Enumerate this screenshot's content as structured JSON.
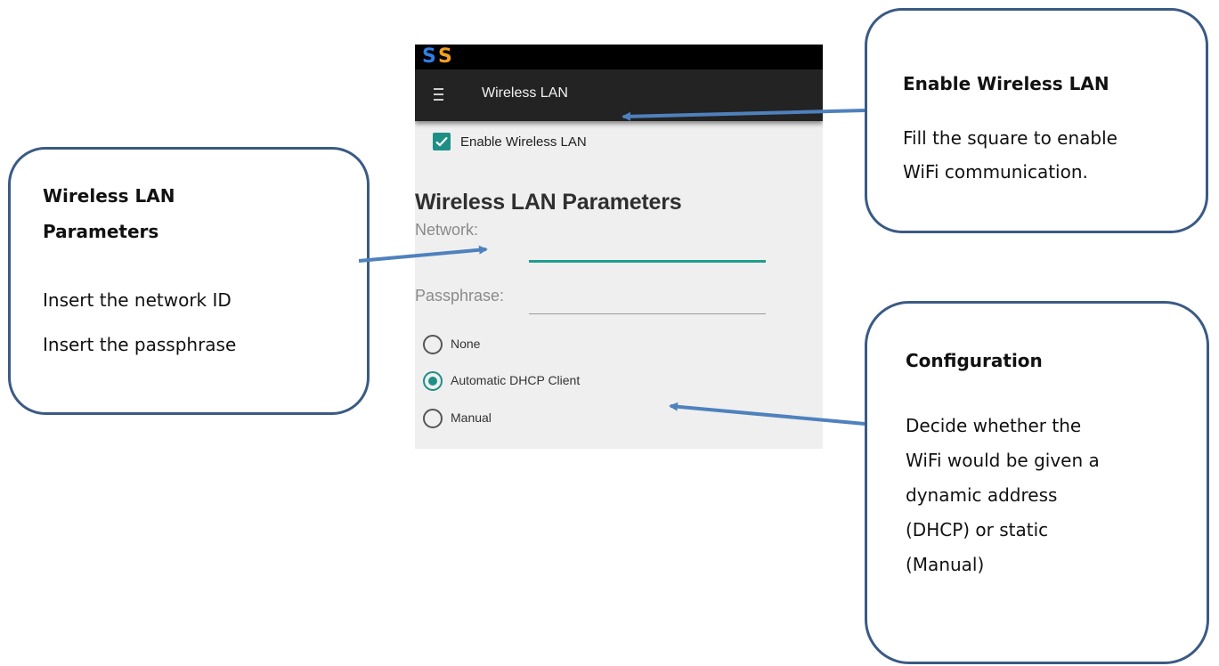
{
  "phone": {
    "status_icons": [
      {
        "glyph": "S",
        "color": "#2f7fe6",
        "name": "s-app-icon-blue"
      },
      {
        "glyph": "S",
        "color": "#f0a020",
        "name": "s-app-icon-orange"
      }
    ],
    "appbar_title": "Wireless LAN",
    "enable_checkbox": {
      "label": "Enable Wireless LAN",
      "checked": true
    },
    "section_title": "Wireless LAN Parameters",
    "network_label": "Network:",
    "passphrase_label": "Passphrase:",
    "network_value": "",
    "passphrase_value": "",
    "radio_options": [
      {
        "label": "None",
        "selected": false
      },
      {
        "label": "Automatic DHCP Client",
        "selected": true
      },
      {
        "label": "Manual",
        "selected": false
      }
    ],
    "accent_color": "#1e8f86"
  },
  "callouts": {
    "enable": {
      "title": "Enable Wireless LAN",
      "line1": "Fill the square to enable",
      "line2": "WiFi communication."
    },
    "params": {
      "title_line1": "Wireless LAN",
      "title_line2": "Parameters",
      "line1": "Insert the network ID",
      "line2": "Insert the passphrase"
    },
    "config": {
      "title": "Configuration",
      "lines": [
        "Decide whether the",
        "WiFi would be given a",
        "dynamic address",
        "(DHCP) or static",
        "(Manual)"
      ]
    }
  },
  "colors": {
    "callout_border": "#3b5a84",
    "arrow": "#4f81bd"
  }
}
